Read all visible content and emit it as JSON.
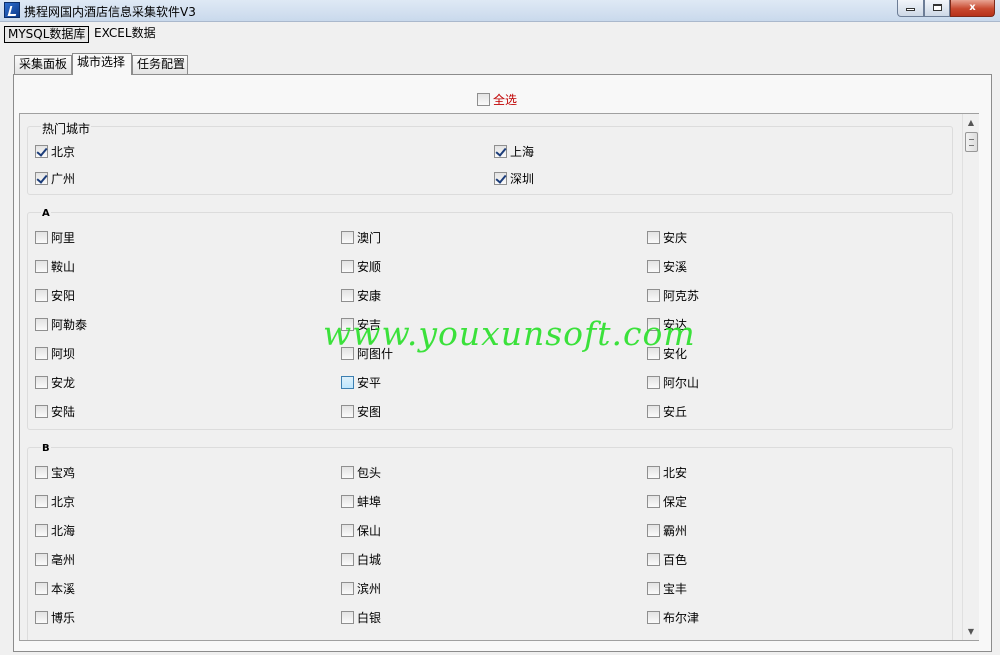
{
  "window": {
    "title": "携程网国内酒店信息采集软件V3",
    "buttons": {
      "minimize": "",
      "maximize": "",
      "close": "x"
    }
  },
  "menu": {
    "items": [
      "MYSQL数据库",
      "EXCEL数据"
    ]
  },
  "tabs": [
    {
      "label": "采集面板",
      "active": false
    },
    {
      "label": "城市选择",
      "active": true
    },
    {
      "label": "任务配置",
      "active": false
    }
  ],
  "select_all": {
    "label": "全选",
    "checked": false,
    "color": "#c00000"
  },
  "hot_cities": {
    "title": "热门城市",
    "items": [
      {
        "label": "北京",
        "checked": true
      },
      {
        "label": "上海",
        "checked": true
      },
      {
        "label": "广州",
        "checked": true
      },
      {
        "label": "深圳",
        "checked": true
      }
    ]
  },
  "group_a": {
    "title": "A",
    "items": [
      {
        "label": "阿里",
        "checked": false
      },
      {
        "label": "澳门",
        "checked": false
      },
      {
        "label": "安庆",
        "checked": false
      },
      {
        "label": "鞍山",
        "checked": false
      },
      {
        "label": "安顺",
        "checked": false
      },
      {
        "label": "安溪",
        "checked": false
      },
      {
        "label": "安阳",
        "checked": false
      },
      {
        "label": "安康",
        "checked": false
      },
      {
        "label": "阿克苏",
        "checked": false
      },
      {
        "label": "阿勒泰",
        "checked": false
      },
      {
        "label": "安吉",
        "checked": false
      },
      {
        "label": "安达",
        "checked": false
      },
      {
        "label": "阿坝",
        "checked": false
      },
      {
        "label": "阿图什",
        "checked": false
      },
      {
        "label": "安化",
        "checked": false
      },
      {
        "label": "安龙",
        "checked": false
      },
      {
        "label": "安平",
        "checked": false,
        "hover": true
      },
      {
        "label": "阿尔山",
        "checked": false
      },
      {
        "label": "安陆",
        "checked": false
      },
      {
        "label": "安图",
        "checked": false
      },
      {
        "label": "安丘",
        "checked": false
      }
    ]
  },
  "group_b": {
    "title": "B",
    "items": [
      {
        "label": "宝鸡",
        "checked": false
      },
      {
        "label": "包头",
        "checked": false
      },
      {
        "label": "北安",
        "checked": false
      },
      {
        "label": "北京",
        "checked": false
      },
      {
        "label": "蚌埠",
        "checked": false
      },
      {
        "label": "保定",
        "checked": false
      },
      {
        "label": "北海",
        "checked": false
      },
      {
        "label": "保山",
        "checked": false
      },
      {
        "label": "霸州",
        "checked": false
      },
      {
        "label": "亳州",
        "checked": false
      },
      {
        "label": "白城",
        "checked": false
      },
      {
        "label": "百色",
        "checked": false
      },
      {
        "label": "本溪",
        "checked": false
      },
      {
        "label": "滨州",
        "checked": false
      },
      {
        "label": "宝丰",
        "checked": false
      },
      {
        "label": "博乐",
        "checked": false
      },
      {
        "label": "白银",
        "checked": false
      },
      {
        "label": "布尔津",
        "checked": false
      }
    ]
  },
  "watermark": "www.youxunsoft.com",
  "scrollbar": {
    "up": "▲",
    "down": "▼"
  }
}
